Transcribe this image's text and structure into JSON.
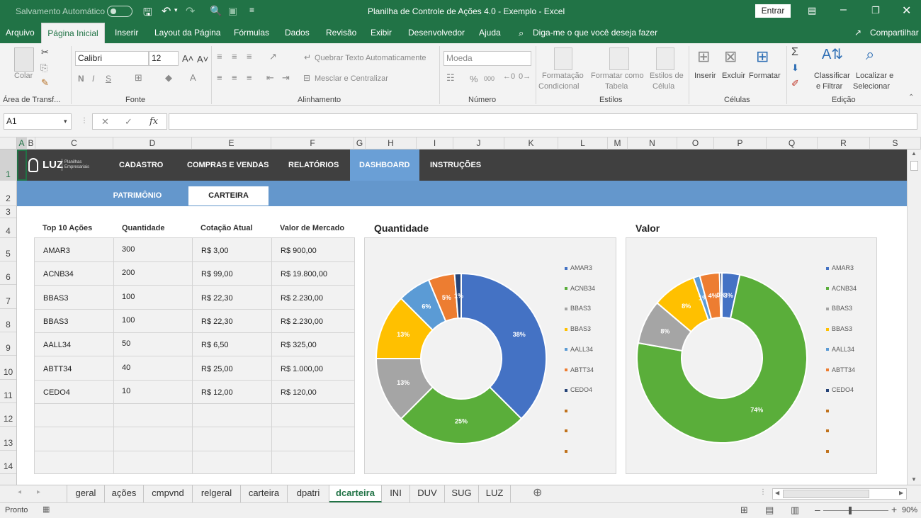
{
  "titlebar": {
    "autosave_label": "Salvamento Automático",
    "autosave_state": "Desativado",
    "title": "Planilha de Controle de Ações 4.0 - Exemplo  -  Excel",
    "signin_label": "Entrar"
  },
  "ribbon_tabs": [
    "Arquivo",
    "Página Inicial",
    "Inserir",
    "Layout da Página",
    "Fórmulas",
    "Dados",
    "Revisão",
    "Exibir",
    "Desenvolvedor",
    "Ajuda"
  ],
  "tell_me": "Diga-me o que você deseja fazer",
  "share_label": "Compartilhar",
  "ribbon": {
    "clipboard": {
      "paste": "Colar",
      "group": "Área de Transf..."
    },
    "font": {
      "name": "Calibri",
      "size": "12",
      "bold": "N",
      "italic": "I",
      "underline": "S",
      "group": "Fonte"
    },
    "alignment": {
      "wrap": "Quebrar Texto Automaticamente",
      "merge": "Mesclar e Centralizar",
      "group": "Alinhamento"
    },
    "number": {
      "format": "Moeda",
      "percent": "%",
      "thousands": "000",
      "group": "Número"
    },
    "styles": {
      "conditional_l1": "Formatação",
      "conditional_l2": "Condicional",
      "table_l1": "Formatar como",
      "table_l2": "Tabela",
      "cell_l1": "Estilos de",
      "cell_l2": "Célula",
      "group": "Estilos"
    },
    "cells": {
      "insert": "Inserir",
      "delete": "Excluir",
      "format": "Formatar",
      "group": "Células"
    },
    "editing": {
      "sort_l1": "Classificar",
      "sort_l2": "e Filtrar",
      "find_l1": "Localizar e",
      "find_l2": "Selecionar",
      "group": "Edição"
    }
  },
  "formula_bar": {
    "name_box": "A1",
    "fx": "fx",
    "value": ""
  },
  "columns": [
    "A",
    "B",
    "C",
    "D",
    "E",
    "F",
    "G",
    "H",
    "I",
    "J",
    "K",
    "L",
    "M",
    "N",
    "O",
    "P",
    "Q",
    "R",
    "S"
  ],
  "rows": [
    "1",
    "2",
    "3",
    "4",
    "5",
    "6",
    "7",
    "8",
    "9",
    "10",
    "11",
    "12",
    "13",
    "14"
  ],
  "dashboard": {
    "logo": "LUZ",
    "logo_tag_l1": "Planilhas",
    "logo_tag_l2": "Empresariais",
    "nav": [
      "CADASTRO",
      "COMPRAS E VENDAS",
      "RELATÓRIOS",
      "DASHBOARD",
      "INSTRUÇÕES"
    ],
    "nav_active": "DASHBOARD",
    "subnav": [
      "PATRIMÔNIO",
      "CARTEIRA"
    ],
    "subnav_active": "CARTEIRA",
    "table": {
      "headers": [
        "Top 10 Ações",
        "Quantidade",
        "Cotação Atual",
        "Valor de Mercado"
      ],
      "rows": [
        [
          "AMAR3",
          "300",
          "R$ 3,00",
          "R$ 900,00"
        ],
        [
          "ACNB34",
          "200",
          "R$ 99,00",
          "R$ 19.800,00"
        ],
        [
          "BBAS3",
          "100",
          "R$ 22,30",
          "R$ 2.230,00"
        ],
        [
          "BBAS3",
          "100",
          "R$ 22,30",
          "R$ 2.230,00"
        ],
        [
          "AALL34",
          "50",
          "R$ 6,50",
          "R$ 325,00"
        ],
        [
          "ABTT34",
          "40",
          "R$ 25,00",
          "R$ 1.000,00"
        ],
        [
          "CEDO4",
          "10",
          "R$ 12,00",
          "R$ 120,00"
        ],
        [
          "",
          "",
          "",
          ""
        ],
        [
          "",
          "",
          "",
          ""
        ],
        [
          "",
          "",
          "",
          ""
        ]
      ]
    }
  },
  "chart_data": [
    {
      "type": "pie",
      "variant": "doughnut",
      "title": "Quantidade",
      "categories": [
        "AMAR3",
        "ACNB34",
        "BBAS3",
        "BBAS3",
        "AALL34",
        "ABTT34",
        "CEDO4"
      ],
      "values": [
        300,
        200,
        100,
        100,
        50,
        40,
        10
      ],
      "data_labels": [
        "38%",
        "25%",
        "13%",
        "13%",
        "6%",
        "5%",
        "1%"
      ],
      "colors": [
        "#4472c4",
        "#5aae3a",
        "#a5a5a5",
        "#ffc000",
        "#5b9bd5",
        "#ed7d31",
        "#264478"
      ],
      "legend_position": "right",
      "legend_extra_entries": 3
    },
    {
      "type": "pie",
      "variant": "doughnut",
      "title": "Valor",
      "categories": [
        "AMAR3",
        "ACNB34",
        "BBAS3",
        "BBAS3",
        "AALL34",
        "ABTT34",
        "CEDO4"
      ],
      "values": [
        900,
        19800,
        2230,
        2230,
        325,
        1000,
        120
      ],
      "data_labels": [
        "3%",
        "74%",
        "8%",
        "8%",
        "1%",
        "4%",
        "0%"
      ],
      "colors": [
        "#4472c4",
        "#5aae3a",
        "#a5a5a5",
        "#ffc000",
        "#5b9bd5",
        "#ed7d31",
        "#264478"
      ],
      "legend_position": "right",
      "legend_extra_entries": 3
    }
  ],
  "sheet_tabs": [
    "geral",
    "ações",
    "cmpvnd",
    "relgeral",
    "carteira",
    "dpatri",
    "dcarteira",
    "INI",
    "DUV",
    "SUG",
    "LUZ"
  ],
  "sheet_tab_active": "dcarteira",
  "status": {
    "ready": "Pronto",
    "zoom": "90%"
  }
}
